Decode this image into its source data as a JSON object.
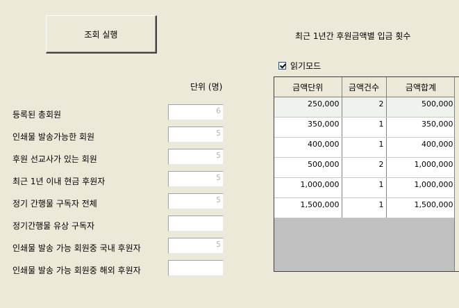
{
  "query_button": "조회 실행",
  "summary_title": "최근 1년간 후원금액별 입금 횟수",
  "unit_label": "단위 (명)",
  "read_mode": {
    "label": "읽기모드",
    "checked": true
  },
  "stats": [
    {
      "label": "등록된 총회원",
      "value": "6"
    },
    {
      "label": "인쇄물 발송가능한 회원",
      "value": "5"
    },
    {
      "label": "후원 선교사가 있는 회원",
      "value": "5"
    },
    {
      "label": "최근 1년 이내 현금 후원자",
      "value": "5"
    },
    {
      "label": "정기 간행물 구독자 전체",
      "value": "5"
    },
    {
      "label": "정기간행물 유상 구독자",
      "value": ""
    },
    {
      "label": "인쇄물 발송 가능 회원중 국내 후원자",
      "value": "5"
    },
    {
      "label": "인쇄물 발송 가능 회원중 해외 후원자",
      "value": ""
    }
  ],
  "grid": {
    "headers": [
      "금액단위",
      "금액건수",
      "금액합계"
    ],
    "rows": [
      [
        "250,000",
        "2",
        "500,000"
      ],
      [
        "350,000",
        "1",
        "350,000"
      ],
      [
        "400,000",
        "1",
        "400,000"
      ],
      [
        "500,000",
        "2",
        "1,000,000"
      ],
      [
        "1,000,000",
        "1",
        "1,000,000"
      ],
      [
        "1,500,000",
        "1",
        "1,500,000"
      ]
    ]
  }
}
